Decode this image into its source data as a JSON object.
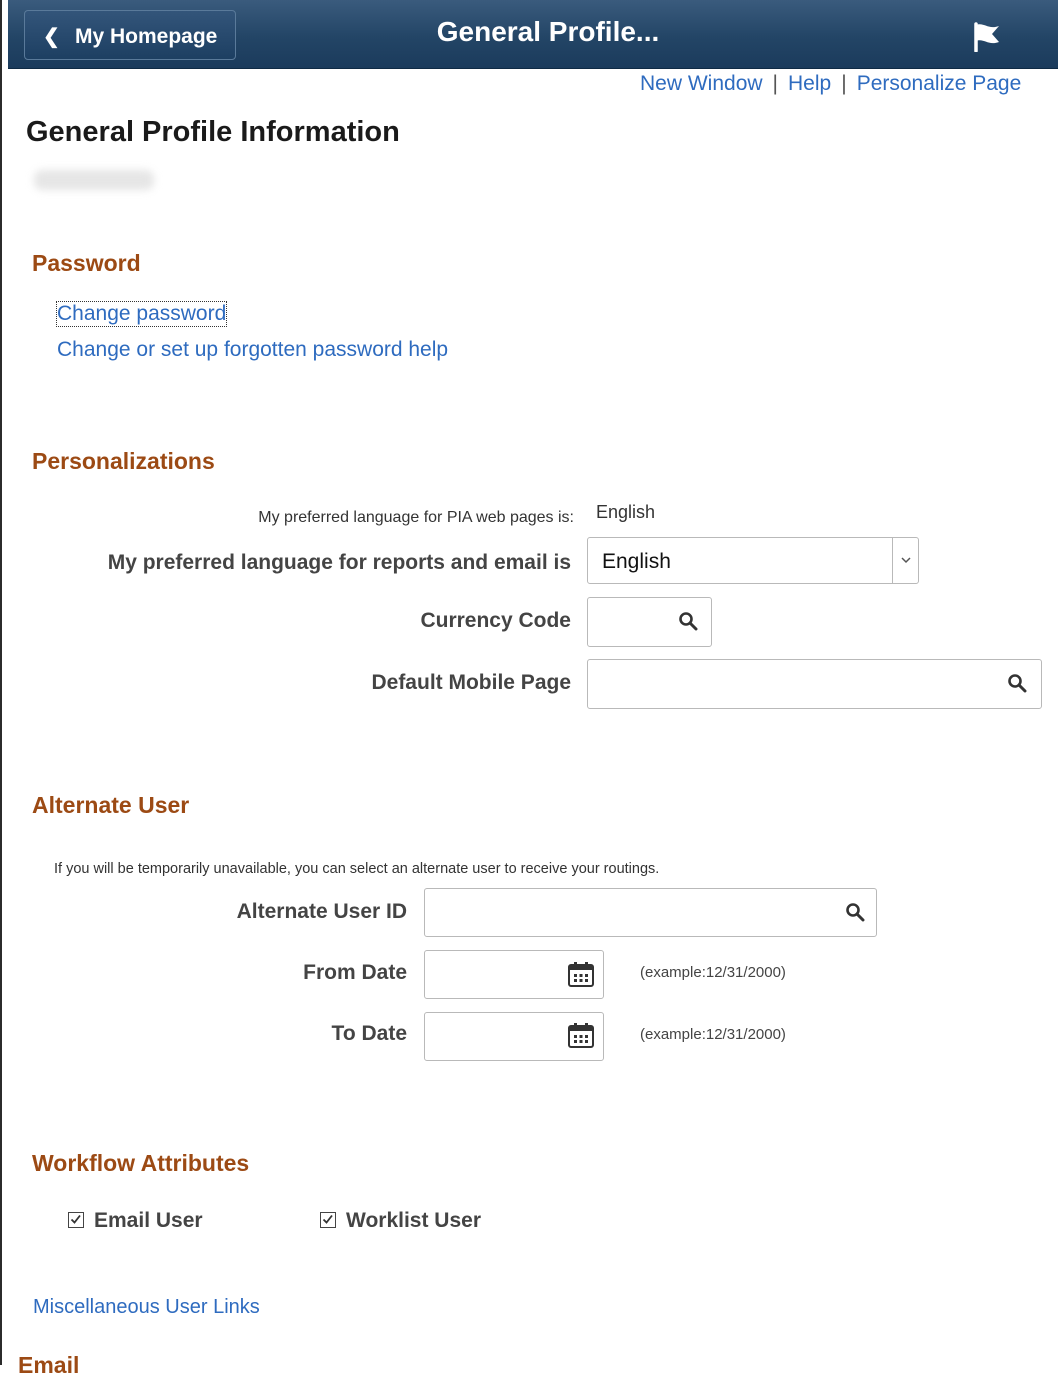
{
  "header": {
    "home_label": "My Homepage",
    "title": "General Profile..."
  },
  "top_links": [
    "New Window",
    "Help",
    "Personalize Page"
  ],
  "page_title": "General Profile Information",
  "password": {
    "heading": "Password",
    "links": [
      "Change password",
      "Change or set up forgotten password help"
    ]
  },
  "personalizations": {
    "heading": "Personalizations",
    "pia_label": "My preferred language for PIA web pages is:",
    "pia_value": "English",
    "reports_label": "My preferred language for reports and email is",
    "reports_value": "English",
    "currency_label": "Currency Code",
    "currency_value": "",
    "mobile_label": "Default Mobile Page",
    "mobile_value": ""
  },
  "alternate_user": {
    "heading": "Alternate User",
    "description": "If you will be temporarily unavailable, you can select an alternate user to receive your routings.",
    "id_label": "Alternate User ID",
    "id_value": "",
    "from_label": "From Date",
    "from_value": "",
    "to_label": "To Date",
    "to_value": "",
    "example": "(example:12/31/2000)"
  },
  "workflow": {
    "heading": "Workflow Attributes",
    "email_user": {
      "label": "Email User",
      "checked": true
    },
    "worklist_user": {
      "label": "Worklist User",
      "checked": true
    }
  },
  "misc_link": "Miscellaneous User Links",
  "email_heading": "Email",
  "colors": {
    "header_bg": "#234566",
    "link": "#2e6bbf",
    "section_heading": "#9c4a14"
  },
  "icons": [
    "chevron-left-icon",
    "flag-icon",
    "kebab-menu-icon",
    "search-icon",
    "calendar-icon",
    "dropdown-arrow-icon",
    "checkbox-icon"
  ]
}
